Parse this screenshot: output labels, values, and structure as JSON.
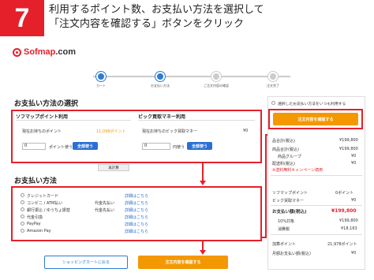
{
  "step": {
    "number": "7",
    "line1": "利用するポイント数、お支払い方法を選択して",
    "line2": "「注文内容を確認する」ボタンをクリック"
  },
  "logo": {
    "brand": "Sofmap",
    "suffix": ".com"
  },
  "progress": {
    "steps": [
      "カート",
      "お支払い方法",
      "ご注文内容の確認",
      "注文完了"
    ]
  },
  "payment_select": {
    "title": "お支払い方法の選択",
    "sofmap_points": {
      "title": "ソフマップポイント利用",
      "holding_label": "現在お持ちのポイント",
      "holding_value": "11,098ポイント",
      "input_value": "0",
      "unit_label": "ポイント使う",
      "use_all": "全部使う"
    },
    "bic_money": {
      "title": "ビック買取マネー利用",
      "holding_label": "現在お持ちのビック買取マネー",
      "holding_value": "¥0",
      "input_value": "0",
      "unit_label": "円使う",
      "use_all": "全部使う"
    },
    "recalc": "再計算"
  },
  "payment_method": {
    "title": "お支払い方法",
    "options": [
      {
        "label": "クレジットカード",
        "fee": "",
        "link": "詳細はこちら"
      },
      {
        "label": "コンビニ / ATM払い",
        "fee": "代金先払い",
        "link": "詳細はこちら"
      },
      {
        "label": "銀行振込 / ゆうちょ振替",
        "fee": "代金先払い",
        "link": "詳細はこちら"
      },
      {
        "label": "代金引換",
        "fee": "",
        "link": "詳細はこちら"
      },
      {
        "label": "PayPay",
        "fee": "",
        "link": "詳細はこちら"
      },
      {
        "label": "Amazon Pay",
        "fee": "",
        "link": "詳細はこちら"
      }
    ]
  },
  "buttons": {
    "back_to_cart": "ショッピングカートに戻る",
    "confirm_order": "注文内容を確認する",
    "confirm_order_side": "注文内容を確認する"
  },
  "sidebar": {
    "remember_label": "選択したお支払い方法をいつも利用する",
    "rows": [
      {
        "label": "品合計(税込)",
        "value": "¥199,800"
      },
      {
        "label": "商品合計(税込)",
        "value": "¥199,800"
      },
      {
        "label": "商品グループ",
        "value": "¥0"
      },
      {
        "label": "配送料(税込)",
        "value": "¥0"
      },
      {
        "label": "※送料無料キャンペーン適用",
        "value": ""
      },
      {
        "label": "ソフマップポイント",
        "value": "0ポイント"
      },
      {
        "label": "ビック買取マネー",
        "value": "¥0"
      },
      {
        "label": "お支払い額(税込)",
        "value": "¥199,800"
      },
      {
        "label": "10%対象",
        "value": "¥199,800"
      },
      {
        "label": "消費税",
        "value": "¥18,163"
      },
      {
        "label": "加算ポイント",
        "value": "21,978ポイント"
      },
      {
        "label": "月額お支払い額(税込)",
        "value": "¥0"
      }
    ]
  },
  "colors": {
    "accent_red": "#e5202b",
    "orange": "#f39800",
    "blue": "#2b6fd3"
  }
}
